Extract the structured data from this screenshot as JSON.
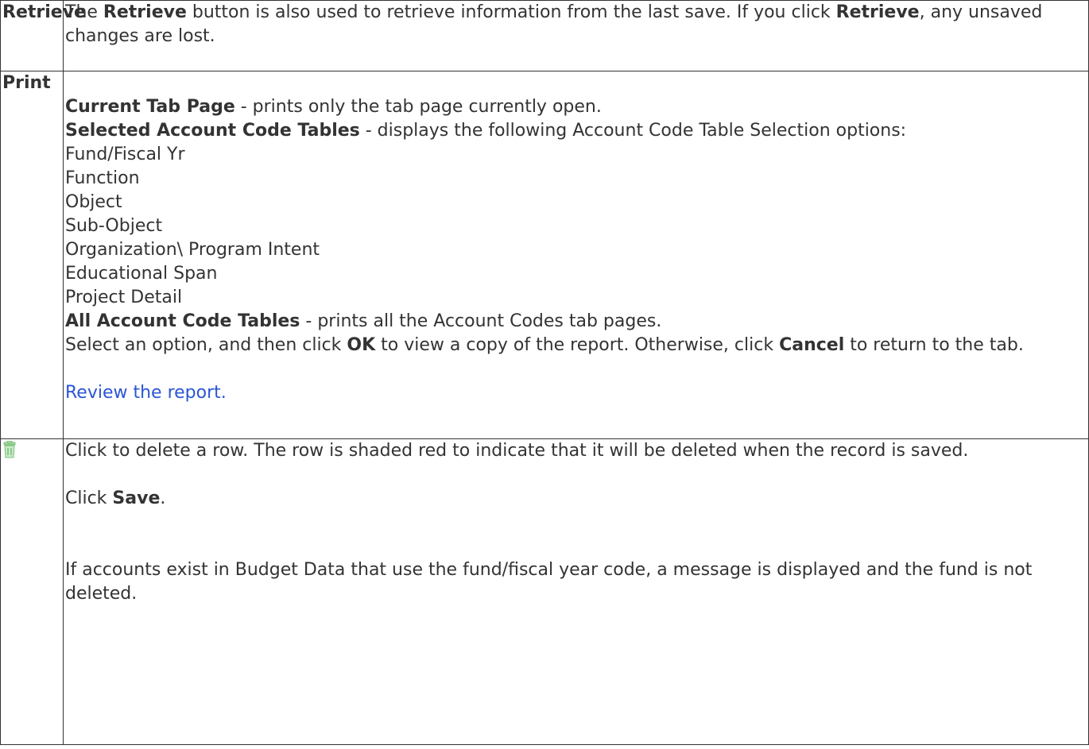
{
  "retrieve": {
    "label": "Retrieve",
    "text_1": "The ",
    "bold_1": "Retrieve",
    "text_2": " button is also used to retrieve information from the last save. If you click ",
    "bold_2": "Retrieve",
    "text_3": ", any unsaved changes are lost."
  },
  "print": {
    "label": "Print",
    "current_tab_bold": "Current Tab Page",
    "current_tab_text": " - prints only the tab page currently open.",
    "selected_tables_bold": "Selected Account Code Tables",
    "selected_tables_text": " - displays the following Account Code Table Selection options:",
    "options": [
      "Fund/Fiscal Yr",
      "Function",
      "Object",
      "Sub-Object",
      "Organization\\ Program Intent",
      "Educational Span",
      "Project Detail"
    ],
    "all_tables_bold": "All Account Code Tables",
    "all_tables_text": " - prints all the Account Codes tab pages.",
    "instruction_1": "Select an option, and then click ",
    "ok_bold": "OK",
    "instruction_2": " to view a copy of the report. Otherwise, click ",
    "cancel_bold": "Cancel",
    "instruction_3": " to return to the tab.",
    "review_link": "Review the report."
  },
  "delete_row": {
    "icon": "trash-icon",
    "icon_color": "#8fcf8f",
    "description": "Click to delete a row. The row is shaded red to indicate that it will be deleted when the record is saved.",
    "click_text": "Click ",
    "save_bold": "Save",
    "period": ".",
    "message": "If accounts exist in Budget Data that use the fund/fiscal year code, a message is displayed and the fund is not deleted."
  }
}
